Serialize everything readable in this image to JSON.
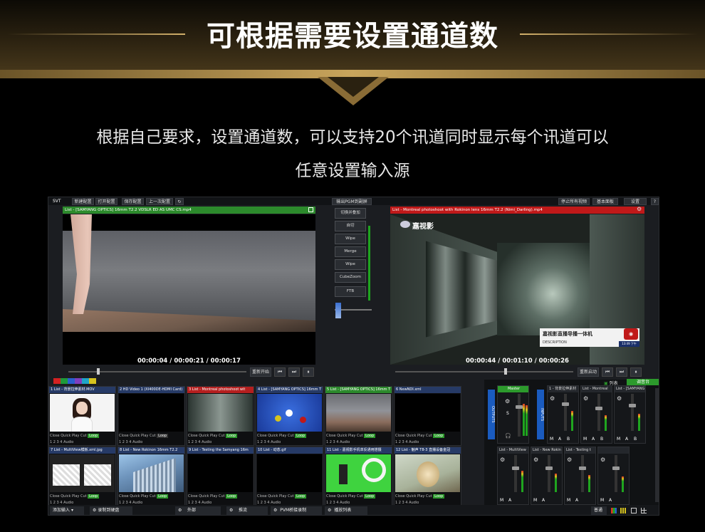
{
  "banner": {
    "title": "可根据需要设置通道数"
  },
  "intro": {
    "line1": "根据自己要求，设置通道数，可以支持20个讯道同时显示每个讯道可以",
    "line2": "任意设置输入源"
  },
  "menu": {
    "app_name": "SVT",
    "items": [
      "新建配置",
      "打开配置",
      "保存配置",
      "上一次配置"
    ],
    "output_dropdown": "输出PGM到副屏",
    "right_items": [
      "停止所有视频",
      "基本面板",
      "设置",
      "?"
    ]
  },
  "preview": {
    "title": "List - [SAMYANG OPTICS] 16mm T2.2 VDSLR ED AS UMC CS.mp4",
    "time_current": "00:00:04",
    "time_total": "00:00:21",
    "time_remaining": "00:00:17",
    "replay_label": "重新开始"
  },
  "program": {
    "title": "List - Montreal photoshoot with Rokinon lens 16mm T2.2 (Nimi_Darling).mp4",
    "time_current": "00:00:44",
    "time_total": "00:01:10",
    "time_remaining": "00:00:26",
    "replay_label": "重新启动",
    "watermark": "嘉视影",
    "lower_third_title": "嘉视影直播导播一体机",
    "lower_third_desc": "DESCRIPTION",
    "lower_third_time": "13:49 下午"
  },
  "transitions": {
    "switch_label": "切换并叠加",
    "items": [
      "自切",
      "Wipe",
      "Merge",
      "Wipe",
      "CubeZoom",
      "FTB"
    ]
  },
  "color_swatches": [
    "#d32222",
    "#1f9a3a",
    "#2a5fcf",
    "#7f3fbf",
    "#1fa5c8",
    "#d6c31e"
  ],
  "inputs": [
    {
      "label": "1  List - 背景拉伸素材.MOV",
      "header": "#263a66"
    },
    {
      "label": "2  HD Video 1 (XI400DE-HDMI Card)",
      "header": "#263a66"
    },
    {
      "label": "3  List - Montreal photoshoot wit",
      "header": "#b51f1f"
    },
    {
      "label": "4  List - [SAMYANG OPTICS] 16mm T",
      "header": "#263a66"
    },
    {
      "label": "5  List - [SAMYANG OPTICS] 16mm T",
      "header": "#2c8a2c"
    },
    {
      "label": "6  NewNDI.xml",
      "header": "#263a66"
    },
    {
      "label": "7  List - MultiView模板.xml.jpg",
      "header": "#263a66"
    },
    {
      "label": "8  List - New Rokinon 16mm T2.2",
      "header": "#263a66"
    },
    {
      "label": "9  List - Testing the Samyang 16m",
      "header": "#263a66"
    },
    {
      "label": "10  List - 动态.gif",
      "header": "#263a66"
    },
    {
      "label": "11  List - 嘉视影手机单反通用搭摄",
      "header": "#263a66"
    },
    {
      "label": "12  List - 魅声 T8-3 直播设备金冠",
      "header": "#263a66"
    }
  ],
  "tile_controls": {
    "row1": "Close  Quick Play  Cut",
    "loop": "Loop",
    "row2": "1  2  3  4    Audio"
  },
  "audio": {
    "master_label": "Master",
    "outputs_label": "OUTPUTS",
    "inputs_label": "INPUTS",
    "header_list": "列表",
    "header_mixer": "调音台",
    "channels": [
      "1 - 背景拉伸素材",
      "List - Montreal",
      "List - [SAMYANG",
      "List - MultiView",
      "List - New Rokin",
      "List - Testing t"
    ],
    "s_label": "S",
    "m_label": "M",
    "a_label": "A",
    "b_label": "B"
  },
  "bottom": {
    "add_input": "添加输入",
    "record_disk": "录制到硬盘",
    "external": "外部",
    "stream": "推流",
    "pvm_record": "PVM桥接录制",
    "playlist": "播放列表",
    "status": "普通"
  }
}
